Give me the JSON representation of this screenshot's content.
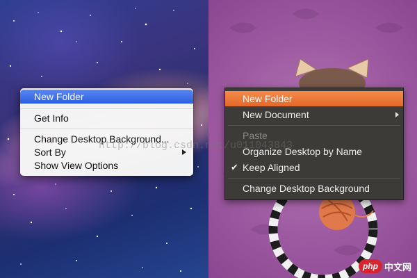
{
  "mac": {
    "menu_items": {
      "new_folder": "New Folder",
      "get_info": "Get Info",
      "change_background": "Change Desktop Background...",
      "sort_by": "Sort By",
      "show_view_options": "Show View Options"
    }
  },
  "ubuntu": {
    "menu_items": {
      "new_folder": "New Folder",
      "new_document": "New Document",
      "paste": "Paste",
      "organize": "Organize Desktop by Name",
      "keep_aligned": "Keep Aligned",
      "change_background": "Change Desktop Background"
    },
    "keep_aligned_checked": true
  },
  "watermark": "http://blog.csdn.net/u011043843",
  "logo": {
    "badge": "php",
    "text": "中文网"
  },
  "colors": {
    "mac_selection": "#2a5fe2",
    "ubuntu_selection": "#e4692a",
    "ubuntu_menu_bg": "#3d3b37",
    "ubuntu_desktop": "#9e5aa1"
  }
}
